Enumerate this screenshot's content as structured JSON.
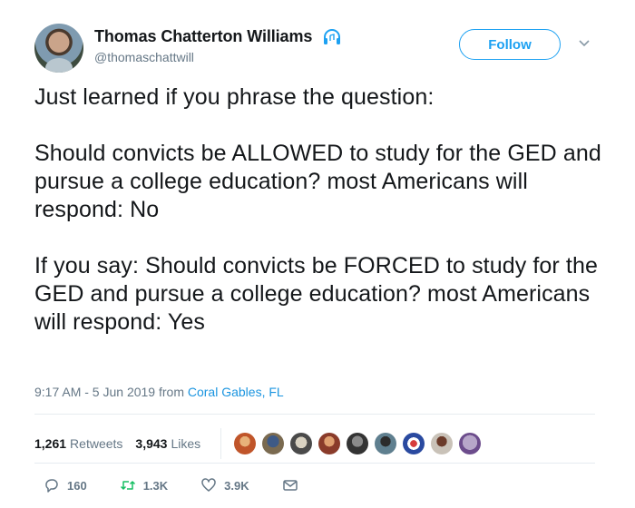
{
  "user": {
    "display_name": "Thomas Chatterton Williams",
    "handle": "@thomaschattwill"
  },
  "follow_label": "Follow",
  "tweet_text": "Just learned if you phrase the question:\n\nShould convicts be ALLOWED to study for the GED and pursue a college education? most Americans will respond: No\n\nIf you say: Should convicts be FORCED to study for the GED and pursue a college education? most Americans will respond: Yes",
  "meta": {
    "timestamp": "9:17 AM - 5 Jun 2019",
    "from_label": "from",
    "location": "Coral Gables, FL"
  },
  "stats": {
    "retweets_count": "1,261",
    "retweets_label": "Retweets",
    "likes_count": "3,943",
    "likes_label": "Likes"
  },
  "actions": {
    "replies": "160",
    "retweets": "1.3K",
    "likes": "3.9K"
  },
  "colors": {
    "accent": "#1da1f2",
    "link": "#1b95e0",
    "muted": "#657786",
    "text": "#14171a"
  },
  "icons": [
    "headphones-icon",
    "chevron-down-icon",
    "reply-icon",
    "retweet-icon",
    "heart-icon",
    "message-icon"
  ]
}
